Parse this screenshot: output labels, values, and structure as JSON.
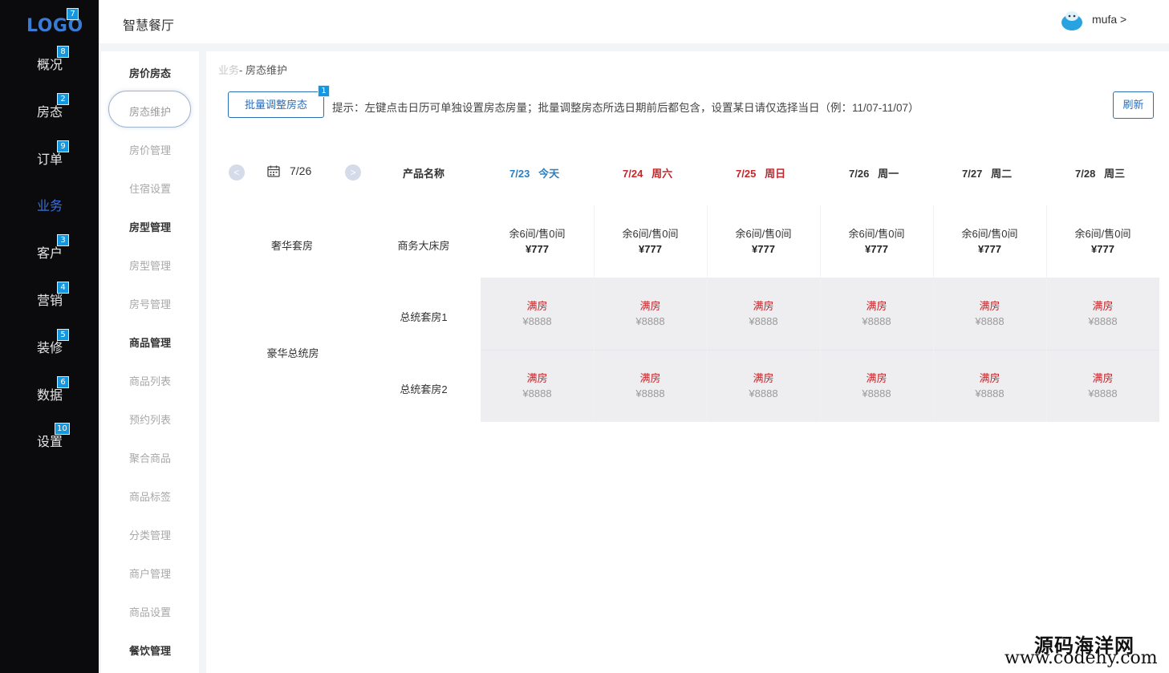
{
  "nav": {
    "logo": "LOGO",
    "logo_badge": "7",
    "items": [
      {
        "label": "概况",
        "badge": "8"
      },
      {
        "label": "房态",
        "badge": "2"
      },
      {
        "label": "订单",
        "badge": "9"
      },
      {
        "label": "业务",
        "badge": ""
      },
      {
        "label": "客户",
        "badge": "3"
      },
      {
        "label": "营销",
        "badge": "4"
      },
      {
        "label": "装修",
        "badge": "5"
      },
      {
        "label": "数据",
        "badge": "6"
      },
      {
        "label": "设置",
        "badge": "10"
      }
    ],
    "active_index": 3
  },
  "header": {
    "title": "智慧餐厅",
    "user": "mufa >"
  },
  "submenu": {
    "items": [
      {
        "label": "房价房态",
        "type": "group"
      },
      {
        "label": "房态维护",
        "type": "selected"
      },
      {
        "label": "房价管理",
        "type": "item"
      },
      {
        "label": "住宿设置",
        "type": "item"
      },
      {
        "label": "房型管理",
        "type": "group"
      },
      {
        "label": "房型管理",
        "type": "item"
      },
      {
        "label": "房号管理",
        "type": "item"
      },
      {
        "label": "商品管理",
        "type": "group"
      },
      {
        "label": "商品列表",
        "type": "item"
      },
      {
        "label": "预约列表",
        "type": "item"
      },
      {
        "label": "聚合商品",
        "type": "item"
      },
      {
        "label": "商品标签",
        "type": "item"
      },
      {
        "label": "分类管理",
        "type": "item"
      },
      {
        "label": "商户管理",
        "type": "item"
      },
      {
        "label": "商品设置",
        "type": "item"
      },
      {
        "label": "餐饮管理",
        "type": "group"
      }
    ]
  },
  "breadcrumb": {
    "parent": "业务",
    "current": "- 房态维护"
  },
  "toolbar": {
    "batch_label": "批量调整房态",
    "batch_badge": "1",
    "tip": "提示：左键点击日历可单独设置房态房量；批量调整房态所选日期前后都包含，设置某日请仅选择当日（例：11/07-11/07）",
    "refresh_label": "刷新"
  },
  "calendar": {
    "prev_symbol": "<",
    "next_symbol": ">",
    "current_date": "7/26",
    "product_header": "产品名称",
    "dates": [
      {
        "date": "7/23",
        "day": "今天",
        "kind": "today"
      },
      {
        "date": "7/24",
        "day": "周六",
        "kind": "weekend"
      },
      {
        "date": "7/25",
        "day": "周日",
        "kind": "weekend"
      },
      {
        "date": "7/26",
        "day": "周一",
        "kind": "normal"
      },
      {
        "date": "7/27",
        "day": "周二",
        "kind": "normal"
      },
      {
        "date": "7/28",
        "day": "周三",
        "kind": "normal"
      }
    ],
    "categories": [
      {
        "name": "奢华套房"
      },
      {
        "name": "豪华总统房"
      }
    ],
    "rooms": [
      {
        "name": "商务大床房",
        "full": false,
        "status": "余6间/售0间",
        "price": "¥777"
      },
      {
        "name": "总统套房1",
        "full": true,
        "status": "满房",
        "price": "¥8888"
      },
      {
        "name": "总统套房2",
        "full": true,
        "status": "满房",
        "price": "¥8888"
      }
    ]
  },
  "watermark": {
    "line1": "源码海洋网",
    "line2": "www.codehy.com"
  },
  "colors": {
    "nav_bg": "#0b0b0d",
    "accent": "#2d6eb8",
    "weekend": "#c0282d",
    "today": "#2e7fbf",
    "badge": "#1597e0"
  }
}
